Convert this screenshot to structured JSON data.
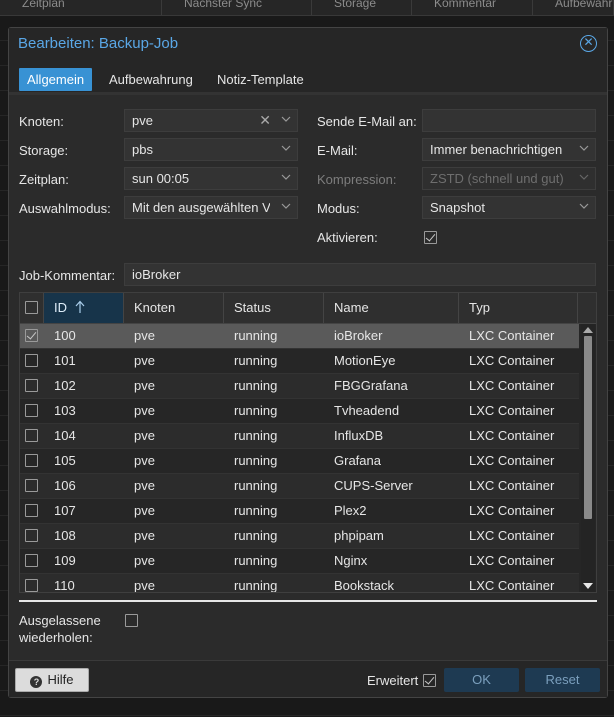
{
  "background": {
    "columns": [
      "Zeitplan",
      "Nächster Sync",
      "Storage",
      "Kommentar",
      "Aufbewahrung"
    ]
  },
  "dialog": {
    "title": "Bearbeiten: Backup-Job",
    "tabs": [
      {
        "label": "Allgemein",
        "active": true
      },
      {
        "label": "Aufbewahrung",
        "active": false
      },
      {
        "label": "Notiz-Template",
        "active": false
      }
    ]
  },
  "form": {
    "knoten": {
      "label": "Knoten:",
      "value": "pve"
    },
    "storage": {
      "label": "Storage:",
      "value": "pbs"
    },
    "zeitplan": {
      "label": "Zeitplan:",
      "value": "sun 00:05"
    },
    "auswahlmodus": {
      "label": "Auswahlmodus:",
      "value": "Mit den ausgewählten VMs"
    },
    "email_to": {
      "label": "Sende E-Mail an:",
      "value": ""
    },
    "email": {
      "label": "E-Mail:",
      "value": "Immer benachrichtigen"
    },
    "kompression": {
      "label": "Kompression:",
      "value": "ZSTD (schnell und gut)",
      "disabled": true
    },
    "modus": {
      "label": "Modus:",
      "value": "Snapshot"
    },
    "aktivieren": {
      "label": "Aktivieren:",
      "checked": true
    },
    "kommentar": {
      "label": "Job-Kommentar:",
      "value": "ioBroker"
    }
  },
  "grid": {
    "sort_icon": "sort-ascending-icon",
    "columns": [
      "ID",
      "Knoten",
      "Status",
      "Name",
      "Typ"
    ],
    "rows": [
      {
        "id": "100",
        "node": "pve",
        "status": "running",
        "name": "ioBroker",
        "type": "LXC Container",
        "selected": true
      },
      {
        "id": "101",
        "node": "pve",
        "status": "running",
        "name": "MotionEye",
        "type": "LXC Container",
        "selected": false
      },
      {
        "id": "102",
        "node": "pve",
        "status": "running",
        "name": "FBGGrafana",
        "type": "LXC Container",
        "selected": false
      },
      {
        "id": "103",
        "node": "pve",
        "status": "running",
        "name": "Tvheadend",
        "type": "LXC Container",
        "selected": false
      },
      {
        "id": "104",
        "node": "pve",
        "status": "running",
        "name": "InfluxDB",
        "type": "LXC Container",
        "selected": false
      },
      {
        "id": "105",
        "node": "pve",
        "status": "running",
        "name": "Grafana",
        "type": "LXC Container",
        "selected": false
      },
      {
        "id": "106",
        "node": "pve",
        "status": "running",
        "name": "CUPS-Server",
        "type": "LXC Container",
        "selected": false
      },
      {
        "id": "107",
        "node": "pve",
        "status": "running",
        "name": "Plex2",
        "type": "LXC Container",
        "selected": false
      },
      {
        "id": "108",
        "node": "pve",
        "status": "running",
        "name": "phpipam",
        "type": "LXC Container",
        "selected": false
      },
      {
        "id": "109",
        "node": "pve",
        "status": "running",
        "name": "Nginx",
        "type": "LXC Container",
        "selected": false
      },
      {
        "id": "110",
        "node": "pve",
        "status": "running",
        "name": "Bookstack",
        "type": "LXC Container",
        "selected": false
      }
    ]
  },
  "repeat": {
    "label_line1": "Ausgelassene",
    "label_line2": "wiederholen:",
    "checked": false
  },
  "footer": {
    "help_label": "Hilfe",
    "advanced_label": "Erweitert",
    "advanced_checked": true,
    "ok_label": "OK",
    "reset_label": "Reset"
  },
  "colors": {
    "accent": "#3892d4",
    "title": "#5aa7e6",
    "dialog_bg": "#2b2b2b"
  }
}
